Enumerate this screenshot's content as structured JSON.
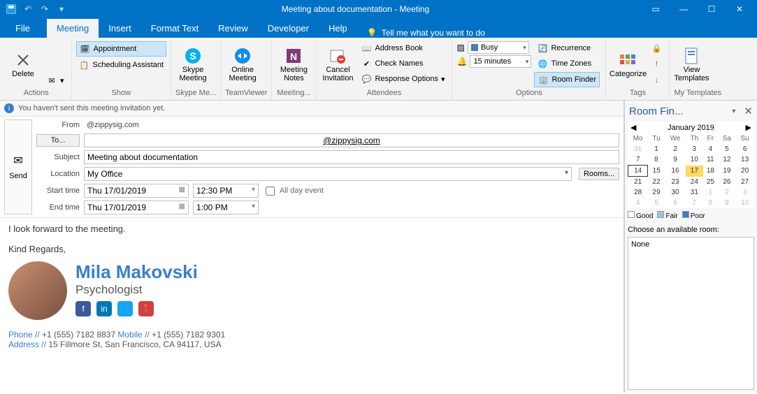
{
  "title": "Meeting about documentation  -  Meeting",
  "menu": {
    "file": "File",
    "meeting": "Meeting",
    "insert": "Insert",
    "format": "Format Text",
    "review": "Review",
    "developer": "Developer",
    "help": "Help",
    "tellme": "Tell me what you want to do"
  },
  "ribbon": {
    "actions": {
      "label": "Actions",
      "delete": "Delete"
    },
    "show": {
      "label": "Show",
      "appointment": "Appointment",
      "scheduling": "Scheduling Assistant"
    },
    "skype": {
      "label": "Skype Me...",
      "btn": "Skype\nMeeting"
    },
    "teamviewer": {
      "label": "TeamViewer",
      "btn": "Online\nMeeting"
    },
    "notes": {
      "label": "Meeting...",
      "btn": "Meeting\nNotes"
    },
    "cancel": {
      "btn": "Cancel\nInvitation"
    },
    "attendees": {
      "label": "Attendees",
      "address": "Address Book",
      "check": "Check Names",
      "resp": "Response Options"
    },
    "options": {
      "label": "Options",
      "busy": "Busy",
      "reminder": "15 minutes",
      "rec": "Recurrence",
      "tz": "Time Zones",
      "room": "Room Finder"
    },
    "tags": {
      "label": "Tags",
      "cat": "Categorize"
    },
    "templates": {
      "label": "My Templates",
      "btn": "View\nTemplates"
    }
  },
  "info": "You haven't sent this meeting invitation yet.",
  "send": "Send",
  "fields": {
    "from_lbl": "From",
    "from_val": "@zippysig.com",
    "to_btn": "To...",
    "to_val": "@zippysig.com",
    "subject_lbl": "Subject",
    "subject_val": "Meeting about documentation",
    "location_lbl": "Location",
    "location_val": "My Office",
    "rooms_btn": "Rooms...",
    "start_lbl": "Start time",
    "start_date": "Thu 17/01/2019",
    "start_time": "12:30 PM",
    "allday": "All day event",
    "end_lbl": "End time",
    "end_date": "Thu 17/01/2019",
    "end_time": "1:00 PM"
  },
  "body": {
    "line1": "I look forward to the meeting.",
    "line2": "Kind Regards,",
    "name": "Mila Makovski",
    "title": "Psychologist",
    "phone_lbl": "Phone //",
    "phone": " +1 (555) 7182 8837 ",
    "mobile_lbl": "Mobile //",
    "mobile": " +1 (555) 7182 9301",
    "addr_lbl": "Address //",
    "addr": " 15 Fillmore St, San Francisco, CA 94117, USA"
  },
  "room": {
    "title": "Room Fin...",
    "month": "January 2019",
    "dow": [
      "Mo",
      "Tu",
      "We",
      "Th",
      "Fr",
      "Sa",
      "Su"
    ],
    "weeks": [
      [
        "31",
        "1",
        "2",
        "3",
        "4",
        "5",
        "6"
      ],
      [
        "7",
        "8",
        "9",
        "10",
        "11",
        "12",
        "13"
      ],
      [
        "14",
        "15",
        "16",
        "17",
        "18",
        "19",
        "20"
      ],
      [
        "21",
        "22",
        "23",
        "24",
        "25",
        "26",
        "27"
      ],
      [
        "28",
        "29",
        "30",
        "31",
        "1",
        "2",
        "3"
      ],
      [
        "4",
        "5",
        "6",
        "7",
        "8",
        "9",
        "10"
      ]
    ],
    "good": "Good",
    "fair": "Fair",
    "poor": "Poor",
    "choose": "Choose an available room:",
    "none": "None"
  }
}
